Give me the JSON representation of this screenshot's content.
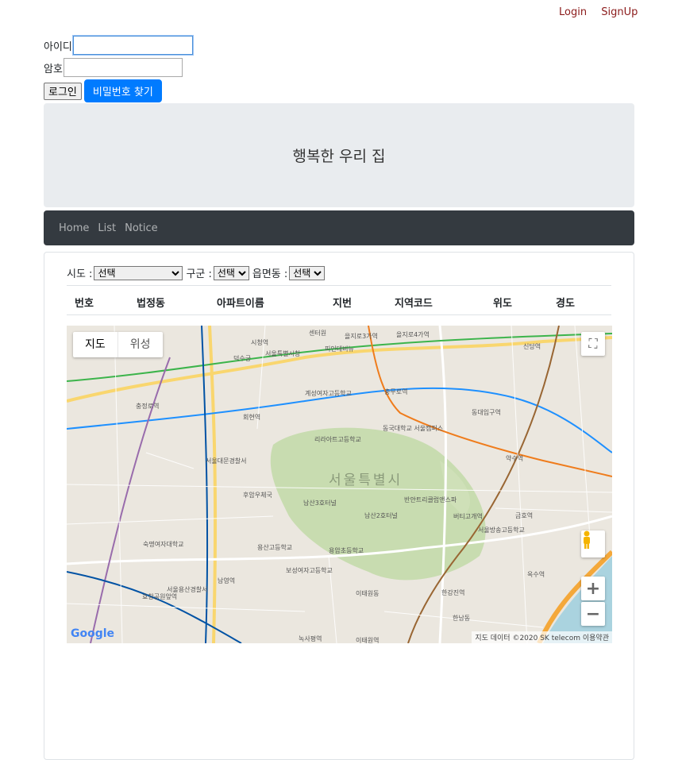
{
  "top_links": {
    "login": "Login",
    "signup": "SignUp"
  },
  "login_form": {
    "id_label": "아이디",
    "pw_label": "암호",
    "id_value": "",
    "pw_value": "",
    "login_button": "로그인",
    "find_pw_button": "비밀번호 찾기"
  },
  "jumbotron": {
    "title": "행복한 우리 집"
  },
  "navbar": {
    "items": [
      "Home",
      "List",
      "Notice"
    ]
  },
  "filters": {
    "sido_label": "시도 :",
    "sido_value": "선택",
    "gugun_label": "구군 :",
    "gugun_value": "선택",
    "dong_label": "읍면동 :",
    "dong_value": "선택"
  },
  "table": {
    "headers": [
      "번호",
      "법정동",
      "아파트이름",
      "지번",
      "지역코드",
      "위도",
      "경도"
    ]
  },
  "map": {
    "type_buttons": [
      "지도",
      "위성"
    ],
    "city_label": "서울특별시",
    "place_labels": [
      "센터원",
      "을지로3가역",
      "을지로4가역",
      "시청역",
      "서울특별시청",
      "덕수궁",
      "피인데비뉴",
      "신당역",
      "충정로역",
      "회현역",
      "계성여자고등학교",
      "충무로역",
      "동대입구역",
      "동국대학교 서울캠퍼스",
      "리라아트고등학교",
      "약수역",
      "서울대문경찰서",
      "후암우체국",
      "남산3호터널",
      "남산2호터널",
      "반얀트리클럽앤스파",
      "버티고개역",
      "금호역",
      "숙명여자대학교",
      "용산고등학교",
      "용암초등학교",
      "보성여자고등학교",
      "이태원동",
      "한강진역",
      "남영역",
      "서울용산경찰서",
      "효창공원앞역",
      "옥수역",
      "서울방송고등학교",
      "한남동",
      "녹사평역",
      "이태원역"
    ],
    "google_logo": "Google",
    "attribution": "지도 데이터 ©2020 SK telecom   이용약관",
    "zoom_in": "+",
    "zoom_out": "−",
    "fullscreen": "⛶"
  }
}
